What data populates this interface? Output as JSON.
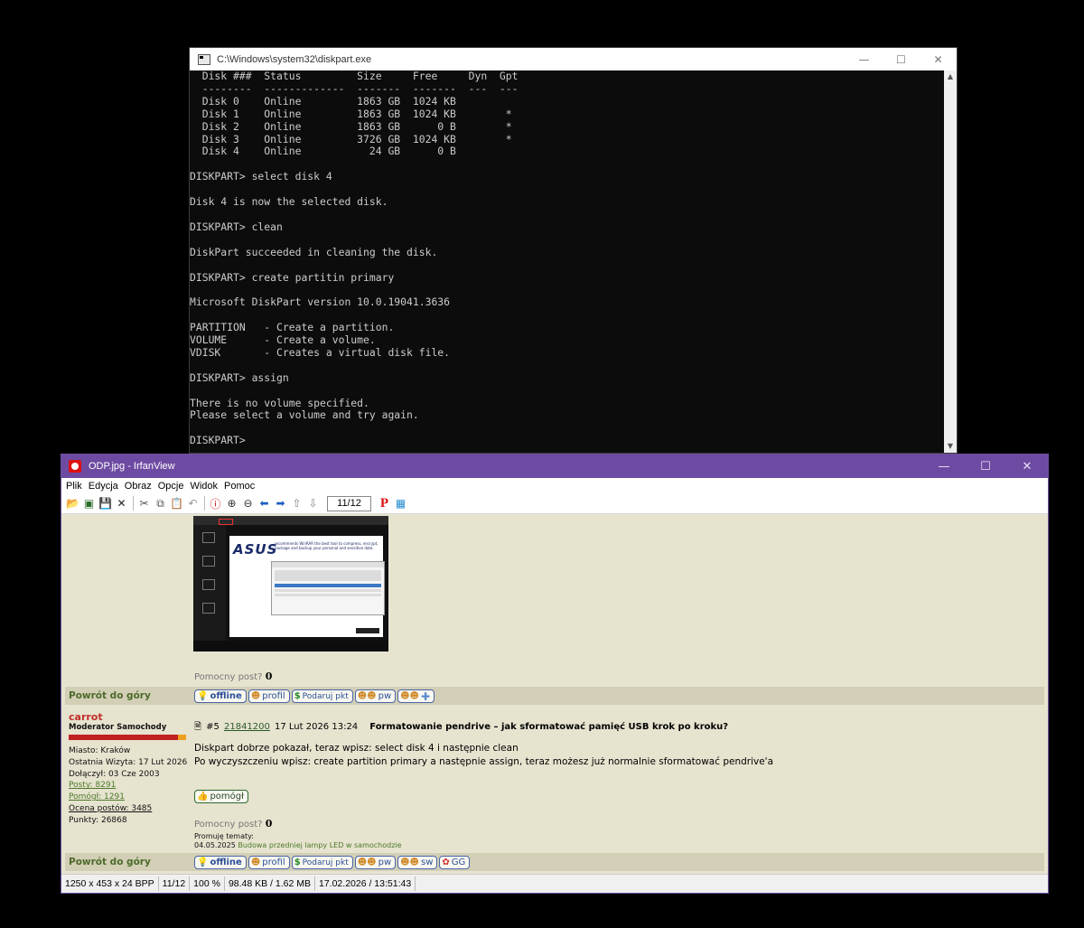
{
  "cmd": {
    "title": "C:\\Windows\\system32\\diskpart.exe",
    "minimize_glyph": "—",
    "maximize_glyph": "☐",
    "close_glyph": "✕",
    "lines": [
      "  Disk ###  Status         Size     Free     Dyn  Gpt",
      "  --------  -------------  -------  -------  ---  ---",
      "  Disk 0    Online         1863 GB  1024 KB",
      "  Disk 1    Online         1863 GB  1024 KB        *",
      "  Disk 2    Online         1863 GB      0 B        *",
      "  Disk 3    Online         3726 GB  1024 KB        *",
      "  Disk 4    Online           24 GB      0 B",
      "",
      "DISKPART> select disk 4",
      "",
      "Disk 4 is now the selected disk.",
      "",
      "DISKPART> clean",
      "",
      "DiskPart succeeded in cleaning the disk.",
      "",
      "DISKPART> create partitin primary",
      "",
      "Microsoft DiskPart version 10.0.19041.3636",
      "",
      "PARTITION   - Create a partition.",
      "VOLUME      - Create a volume.",
      "VDISK       - Creates a virtual disk file.",
      "",
      "DISKPART> assign",
      "",
      "There is no volume specified.",
      "Please select a volume and try again.",
      "",
      "DISKPART> "
    ]
  },
  "irfanview": {
    "title": "ODP.jpg - IrfanView",
    "minimize_glyph": "—",
    "maximize_glyph": "☐",
    "close_glyph": "✕",
    "menu": [
      "Plik",
      "Edycja",
      "Obraz",
      "Opcje",
      "Widok",
      "Pomoc"
    ],
    "page_indicator": "11/12",
    "status": {
      "dimensions": "1250 x 453 x 24 BPP",
      "index": "11/12",
      "zoom": "100 %",
      "size": "98.48 KB / 1.62 MB",
      "datetime": "17.02.2026 / 13:51:43"
    }
  },
  "forum": {
    "helpful_label": "Pomocny post?",
    "helpful_count_1": "0",
    "back_to_top": "Powrót do góry",
    "buttons_row1": [
      "offline",
      "profil",
      "Podaruj pkt",
      "pw",
      ""
    ],
    "author": {
      "name": "carrot",
      "role": "Moderator Samochody",
      "city": "Miasto: Kraków",
      "last_visit": "Ostatnia Wizyta: 17 Lut 2026",
      "joined": "Dołączył: 03 Cze 2003",
      "posts": "Posty: 8291",
      "helped": "Pomógł: 1291",
      "ratings": "Ocena postów: 3485",
      "points": "Punkty: 26868"
    },
    "post": {
      "number": "#5",
      "id": "21841200",
      "date": "17 Lut 2026 13:24",
      "topic": "Formatowanie pendrive – jak sformatować pamięć USB krok po kroku?",
      "line1": "Diskpart dobrze pokazał, teraz wpisz: select disk 4 i następnie clean",
      "line2": "Po wyczyszczeniu wpisz: create partition primary a następnie assign, teraz możesz już normalnie sformatować pendrive'a",
      "helped_button": "pomógł",
      "helpful_count": "0",
      "promo_label": "Promuję tematy:",
      "promo_date": "04.05.2025",
      "promo_link": "Budowa przedniej lampy LED w samochodzie"
    },
    "buttons_row2": [
      "offline",
      "profil",
      "Podaruj pkt",
      "pw",
      "sw",
      "GG"
    ],
    "thumbnail": {
      "brand": "ASUS",
      "headline": "recommends WinRAR the best tool to compress, encrypt, package and backup your personal and sensitive data."
    }
  }
}
